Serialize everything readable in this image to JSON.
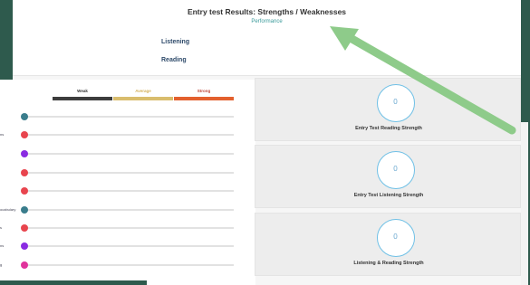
{
  "header": {
    "title": "Entry test Results: Strengths / Weaknesses",
    "subtitle": "Performance",
    "skills": [
      "Listening",
      "Reading"
    ]
  },
  "legend": {
    "weak": "Weak",
    "average": "Average",
    "strong": "Strong"
  },
  "rows": [
    {
      "label": "",
      "color": "#3a7d8c"
    },
    {
      "label": "ns",
      "color": "#e8454e"
    },
    {
      "label": "",
      "color": "#8a2be2"
    },
    {
      "label": "",
      "color": "#e8454e"
    },
    {
      "label": "",
      "color": "#e8454e"
    },
    {
      "label": "ocabulary",
      "color": "#3a7d8c"
    },
    {
      "label": "s",
      "color": "#e8454e"
    },
    {
      "label": "ns",
      "color": "#8a2be2"
    },
    {
      "label": "g",
      "color": "#e0339c"
    }
  ],
  "cards": [
    {
      "value": "0",
      "label": "Entry Test Reading Strength"
    },
    {
      "value": "0",
      "label": "Entry Test Listening Strength"
    },
    {
      "value": "0",
      "label": "Listening & Reading Strength"
    }
  ],
  "colors": {
    "frame": "#2e5a4d",
    "arrow": "#8ecb8a",
    "ring": "#6fc0e6"
  }
}
